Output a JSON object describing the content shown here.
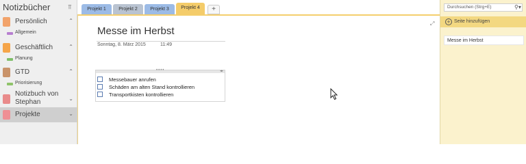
{
  "sidebar": {
    "title": "Notizbücher",
    "notebooks": [
      {
        "label": "Persönlich",
        "color": "#f2a36b",
        "section": {
          "label": "Allgemein",
          "color": "#b77fd0"
        }
      },
      {
        "label": "Geschäftlich",
        "color": "#f5a54a",
        "section": {
          "label": "Planung",
          "color": "#7fbf6a"
        }
      },
      {
        "label": "GTD",
        "color": "#c9936a",
        "section": {
          "label": "Priorisierung",
          "color": "#8fc36a"
        }
      },
      {
        "label": "Notizbuch von\nStephan",
        "color": "#e98b8b"
      },
      {
        "label": "Projekte",
        "color": "#ef8f94"
      }
    ]
  },
  "tabs": [
    {
      "label": "Projekt 1",
      "color": "#9cbbe6"
    },
    {
      "label": "Projekt 2",
      "color": "#b9c3d1"
    },
    {
      "label": "Projekt 3",
      "color": "#9cbbe6"
    },
    {
      "label": "Projekt 4",
      "color": "#f4cc6a"
    }
  ],
  "add_tab_label": "+",
  "page": {
    "title": "Messe im Herbst",
    "date": "Sonntag, 8. März 2015",
    "time": "11:49",
    "todos": [
      "Messebauer anrufen",
      "Schäden am alten Stand kontrollieren",
      "Transportkisten kontrollieren"
    ]
  },
  "right_pane": {
    "search_placeholder": "Durchsuchen (Strg+E)",
    "add_page_label": "Seite hinzufügen",
    "pages": [
      "Messe im Herbst"
    ]
  }
}
